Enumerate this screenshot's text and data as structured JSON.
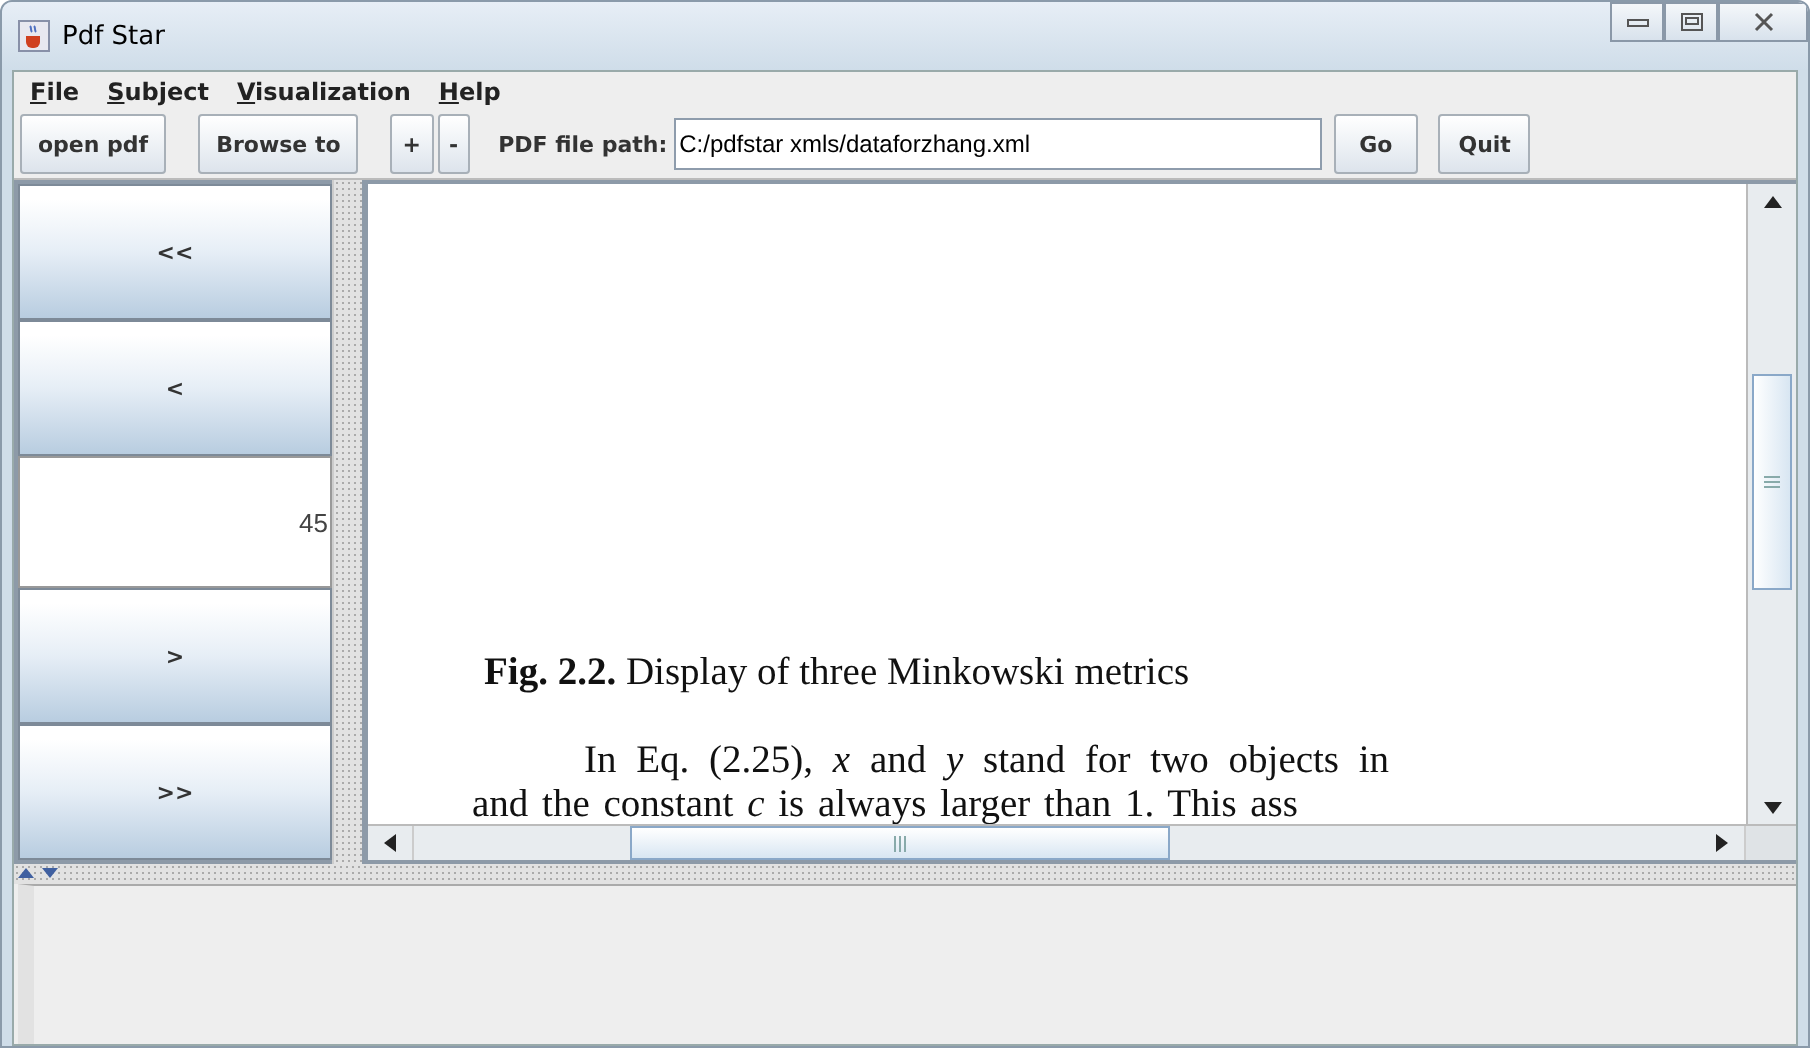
{
  "window": {
    "title": "Pdf Star"
  },
  "menu": [
    "File",
    "Subject",
    "Visualization",
    "Help"
  ],
  "toolbar": {
    "open_button": "open pdf",
    "browse_button": "Browse to",
    "zoom_in": "+",
    "zoom_out": "-",
    "path_label": "PDF file path:",
    "path_value": "C:/pdfstar xmls/dataforzhang.xml",
    "go_button": "Go",
    "quit_button": "Quit"
  },
  "navigation": {
    "first": "<<",
    "previous": "<",
    "page": "45",
    "next": ">",
    "last": ">>"
  },
  "document": {
    "lines": [
      {
        "kind": "caption",
        "text": "**Fig. 2.2.** Display of three Minkowski metrics"
      },
      {
        "kind": "para",
        "text": "In Eq. (2.25), *x* and *y* stand for two objects in"
      },
      {
        "kind": "cont",
        "text": "and the constant *c* is always larger than 1. This ass"
      }
    ]
  }
}
